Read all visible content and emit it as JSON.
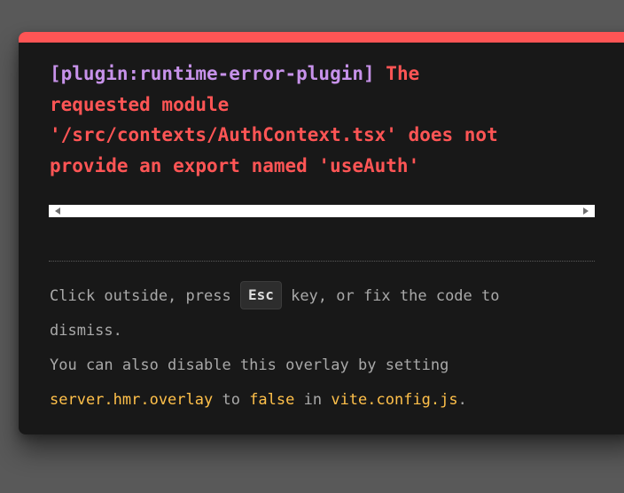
{
  "error": {
    "plugin": "[plugin:runtime-error-plugin]",
    "message_line1": " The",
    "message_line2": "requested module",
    "message_line3": "'/src/contexts/AuthContext.tsx' does not",
    "message_line4": "provide an export named 'useAuth'"
  },
  "tip": {
    "line1_before": "Click outside, press ",
    "key": "Esc",
    "line1_after": " key, or fix the code to",
    "line2": "dismiss.",
    "line3": "You can also disable this overlay by setting",
    "config_option": "server.hmr.overlay",
    "to_text": " to ",
    "false_value": "false",
    "in_text": " in ",
    "config_file": "vite.config.js",
    "period": "."
  },
  "colors": {
    "background": "#595959",
    "overlay": "#181818",
    "accent_bar": "#ff5555",
    "error_text": "#ff5555",
    "plugin_text": "#c792ea",
    "tip_text": "#a9a9a9",
    "code_text": "#ffc04a"
  },
  "icons": [
    "scroll-left-arrow-icon",
    "scroll-right-arrow-icon"
  ]
}
